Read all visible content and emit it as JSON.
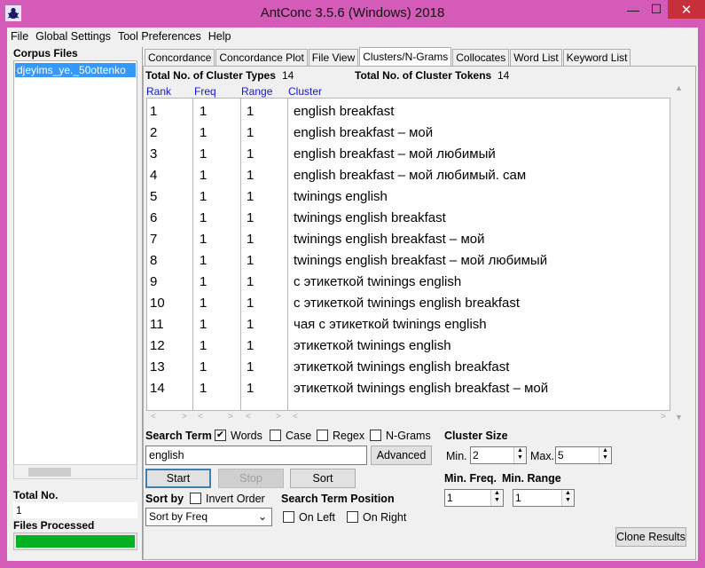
{
  "window": {
    "title": "AntConc 3.5.6 (Windows) 2018",
    "minimize": "—",
    "maximize": "☐",
    "close": "✕"
  },
  "menu": [
    "File",
    "Global Settings",
    "Tool Preferences",
    "Help"
  ],
  "left_pane": {
    "corpus_label": "Corpus Files",
    "corpus_files": [
      "djeyims_ye._50ottenko"
    ],
    "total_label": "Total No.",
    "total_value": "1",
    "files_processed_label": "Files Processed",
    "files_processed_progress": 1.0
  },
  "tabs": [
    {
      "label": "Concordance",
      "active": false
    },
    {
      "label": "Concordance Plot",
      "active": false
    },
    {
      "label": "File View",
      "active": false
    },
    {
      "label": "Clusters/N-Grams",
      "active": true
    },
    {
      "label": "Collocates",
      "active": false
    },
    {
      "label": "Word List",
      "active": false
    },
    {
      "label": "Keyword List",
      "active": false
    }
  ],
  "stats": {
    "types_label": "Total No. of Cluster Types",
    "types_value": "14",
    "tokens_label": "Total No. of Cluster Tokens",
    "tokens_value": "14"
  },
  "columns": [
    "Rank",
    "Freq",
    "Range",
    "Cluster"
  ],
  "rows": [
    {
      "rank": "1",
      "freq": "1",
      "range": "1",
      "cluster": "english breakfast"
    },
    {
      "rank": "2",
      "freq": "1",
      "range": "1",
      "cluster": "english breakfast – мой"
    },
    {
      "rank": "3",
      "freq": "1",
      "range": "1",
      "cluster": "english breakfast – мой любимый"
    },
    {
      "rank": "4",
      "freq": "1",
      "range": "1",
      "cluster": "english breakfast – мой любимый. сам"
    },
    {
      "rank": "5",
      "freq": "1",
      "range": "1",
      "cluster": "twinings english"
    },
    {
      "rank": "6",
      "freq": "1",
      "range": "1",
      "cluster": "twinings english breakfast"
    },
    {
      "rank": "7",
      "freq": "1",
      "range": "1",
      "cluster": "twinings english breakfast – мой"
    },
    {
      "rank": "8",
      "freq": "1",
      "range": "1",
      "cluster": "twinings english breakfast – мой любимый"
    },
    {
      "rank": "9",
      "freq": "1",
      "range": "1",
      "cluster": "с этикеткой twinings english"
    },
    {
      "rank": "10",
      "freq": "1",
      "range": "1",
      "cluster": "с этикеткой twinings english breakfast"
    },
    {
      "rank": "11",
      "freq": "1",
      "range": "1",
      "cluster": "чая с этикеткой twinings english"
    },
    {
      "rank": "12",
      "freq": "1",
      "range": "1",
      "cluster": "этикеткой twinings english"
    },
    {
      "rank": "13",
      "freq": "1",
      "range": "1",
      "cluster": "этикеткой twinings english breakfast"
    },
    {
      "rank": "14",
      "freq": "1",
      "range": "1",
      "cluster": "этикеткой twinings english breakfast – мой"
    }
  ],
  "search": {
    "term_label": "Search Term",
    "words_label": "Words",
    "words_checked": true,
    "case_label": "Case",
    "case_checked": false,
    "regex_label": "Regex",
    "regex_checked": false,
    "ngrams_label": "N-Grams",
    "ngrams_checked": false,
    "term_value": "english",
    "advanced_label": "Advanced",
    "start_label": "Start",
    "stop_label": "Stop",
    "sort_label": "Sort"
  },
  "cluster_size": {
    "label": "Cluster Size",
    "min_label": "Min.",
    "min_value": "2",
    "max_label": "Max.",
    "max_value": "5"
  },
  "sort": {
    "label": "Sort by",
    "invert_label": "Invert Order",
    "invert_checked": false,
    "selected": "Sort by Freq"
  },
  "position": {
    "label": "Search Term Position",
    "left_label": "On Left",
    "left_checked": false,
    "right_label": "On Right",
    "right_checked": false
  },
  "min_freq": {
    "label": "Min. Freq.",
    "value": "1"
  },
  "min_range": {
    "label": "Min. Range",
    "value": "1"
  },
  "clone_label": "Clone Results",
  "icons": {
    "app": "ant-icon",
    "scroll_up": "▲",
    "scroll_down": "▼",
    "combo_arrow": "⌄",
    "spin_up": "▲",
    "spin_down": "▼",
    "check": "✔"
  }
}
